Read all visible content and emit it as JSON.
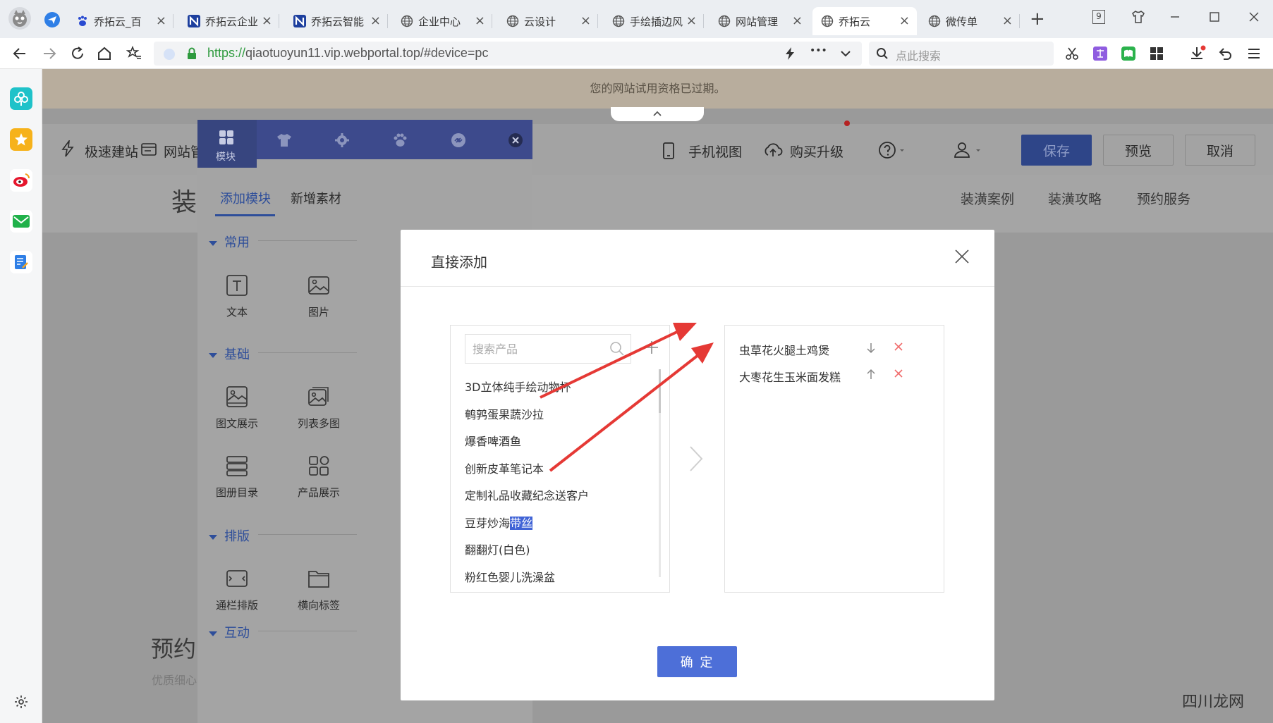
{
  "tabs": [
    {
      "label": "乔拓云_百",
      "icon": "paw-icon",
      "close": "×"
    },
    {
      "label": "乔拓云企业",
      "icon": "n-logo-icon",
      "close": "×"
    },
    {
      "label": "乔拓云智能",
      "icon": "n-logo-icon",
      "close": "×"
    },
    {
      "label": "企业中心",
      "icon": "globe-icon",
      "close": "×"
    },
    {
      "label": "云设计",
      "icon": "globe-icon",
      "close": "×"
    },
    {
      "label": "手绘插边风",
      "icon": "globe-icon",
      "close": "×"
    },
    {
      "label": "网站管理",
      "icon": "globe-icon",
      "close": "×"
    },
    {
      "label": "乔拓云",
      "icon": "globe-icon",
      "close": "×"
    },
    {
      "label": "微传单",
      "icon": "globe-icon",
      "close": "×"
    }
  ],
  "window": {
    "tab_count": "9",
    "new_tab": "+"
  },
  "address": {
    "url_protocol": "https://",
    "url_rest": "qiaotuoyun11.vip.webportal.top/#device=pc",
    "search_placeholder": "点此搜索",
    "ellipsis": "•••"
  },
  "page": {
    "notice": "您的网站试用资格已过期。",
    "toolbar": {
      "quick_build": "极速建站",
      "site_manage": "网站管",
      "mobile_view": "手机视图",
      "upgrade": "购买升级",
      "save": "保存",
      "preview": "预览",
      "cancel": "取消"
    },
    "nav": [
      "装潢案例",
      "装潢攻略",
      "预约服务"
    ],
    "bg_texts": {
      "big": "装",
      "booking": "预约",
      "sub": "优质细心"
    }
  },
  "panel": {
    "head_label": "模块",
    "tabs": [
      "添加模块",
      "新增素材"
    ],
    "categories": [
      {
        "name": "常用",
        "items": [
          "文本",
          "图片"
        ]
      },
      {
        "name": "基础",
        "items": [
          "图文展示",
          "列表多图",
          "图册目录",
          "产品展示"
        ]
      },
      {
        "name": "排版",
        "items": [
          "通栏排版",
          "横向标签"
        ]
      },
      {
        "name": "互动",
        "items": []
      }
    ]
  },
  "modal": {
    "title": "直接添加",
    "search_placeholder": "搜索产品",
    "products": [
      "3D立体纯手绘动物杯",
      "鹌鹑蛋果蔬沙拉",
      "爆香啤酒鱼",
      "创新皮革笔记本",
      "定制礼品收藏纪念送客户",
      "豆芽炒海带丝",
      "翻翻灯(白色)",
      "粉红色婴儿洗澡盆"
    ],
    "product_highlight": {
      "before": "豆芽炒海",
      "selected": "带丝"
    },
    "selected": [
      "虫草花火腿土鸡煲",
      "大枣花生玉米面发糕"
    ],
    "confirm": "确 定"
  },
  "watermark": "四川龙网",
  "colors": {
    "accent": "#4d6fd8",
    "panel_head": "#3d4a8c",
    "arrow": "#e53935",
    "remove": "#f06a6a",
    "url_green": "#2e9a3e"
  }
}
